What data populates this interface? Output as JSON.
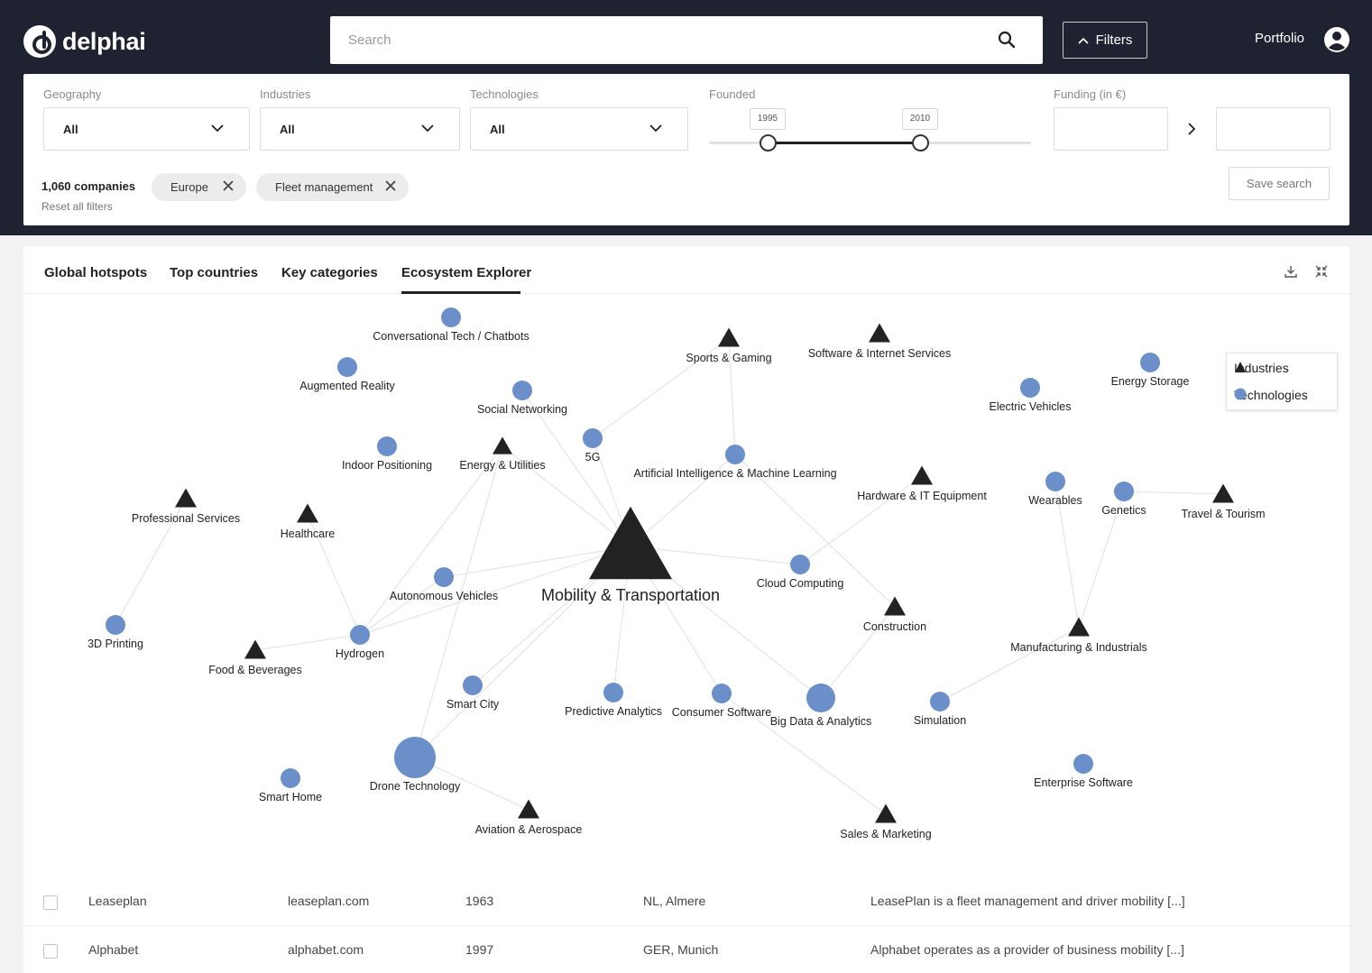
{
  "app": {
    "name": "delphai"
  },
  "header": {
    "search_placeholder": "Search",
    "filters_label": "Filters",
    "portfolio_label": "Portfolio"
  },
  "filters": {
    "geography": {
      "label": "Geography",
      "value": "All"
    },
    "industries": {
      "label": "Industries",
      "value": "All"
    },
    "technologies": {
      "label": "Technologies",
      "value": "All"
    },
    "founded": {
      "label": "Founded",
      "min": "1995",
      "max": "2010"
    },
    "funding": {
      "label": "Funding (in €)"
    },
    "count": "1,060 companies",
    "reset": "Reset all filters",
    "chips": [
      "Europe",
      "Fleet management"
    ],
    "save": "Save search"
  },
  "tabs": [
    "Global hotspots",
    "Top countries",
    "Key categories",
    "Ecosystem Explorer"
  ],
  "active_tab": "Ecosystem Explorer",
  "legend": {
    "industries": "Industries",
    "technologies": "Technologies"
  },
  "colors": {
    "header_bg": "#1f2230",
    "technology_node": "#6a8fc9",
    "industry_node": "#222222"
  },
  "graph": {
    "center": "Mobility & Transportation",
    "nodes": [
      {
        "id": "conv",
        "label": "Conversational Tech / Chatbots",
        "kind": "technology"
      },
      {
        "id": "ar",
        "label": "Augmented Reality",
        "kind": "technology"
      },
      {
        "id": "social",
        "label": "Social Networking",
        "kind": "technology"
      },
      {
        "id": "indoor",
        "label": "Indoor Positioning",
        "kind": "technology"
      },
      {
        "id": "energyu",
        "label": "Energy & Utilities",
        "kind": "industry"
      },
      {
        "id": "fiveg",
        "label": "5G",
        "kind": "technology"
      },
      {
        "id": "sports",
        "label": "Sports & Gaming",
        "kind": "industry"
      },
      {
        "id": "software",
        "label": "Software & Internet Services",
        "kind": "industry"
      },
      {
        "id": "aiml",
        "label": "Artificial Intelligence & Machine Learning",
        "kind": "technology"
      },
      {
        "id": "hardware",
        "label": "Hardware & IT Equipment",
        "kind": "industry"
      },
      {
        "id": "electric",
        "label": "Electric Vehicles",
        "kind": "technology"
      },
      {
        "id": "storage",
        "label": "Energy Storage",
        "kind": "technology"
      },
      {
        "id": "wearables",
        "label": "Wearables",
        "kind": "technology"
      },
      {
        "id": "genetics",
        "label": "Genetics",
        "kind": "technology"
      },
      {
        "id": "travel",
        "label": "Travel & Tourism",
        "kind": "industry"
      },
      {
        "id": "profserv",
        "label": "Professional Services",
        "kind": "industry"
      },
      {
        "id": "health",
        "label": "Healthcare",
        "kind": "industry"
      },
      {
        "id": "autonomous",
        "label": "Autonomous Vehicles",
        "kind": "technology"
      },
      {
        "id": "mobility",
        "label": "Mobility & Transportation",
        "kind": "industry"
      },
      {
        "id": "cloud",
        "label": "Cloud Computing",
        "kind": "technology"
      },
      {
        "id": "construction",
        "label": "Construction",
        "kind": "industry"
      },
      {
        "id": "manufacturing",
        "label": "Manufacturing & Industrials",
        "kind": "industry"
      },
      {
        "id": "print3d",
        "label": "3D Printing",
        "kind": "technology"
      },
      {
        "id": "food",
        "label": "Food & Beverages",
        "kind": "industry"
      },
      {
        "id": "hydrogen",
        "label": "Hydrogen",
        "kind": "technology"
      },
      {
        "id": "smartcity",
        "label": "Smart City",
        "kind": "technology"
      },
      {
        "id": "predictive",
        "label": "Predictive Analytics",
        "kind": "technology"
      },
      {
        "id": "consumer",
        "label": "Consumer Software",
        "kind": "technology"
      },
      {
        "id": "bigdata",
        "label": "Big Data & Analytics",
        "kind": "technology"
      },
      {
        "id": "simulation",
        "label": "Simulation",
        "kind": "technology"
      },
      {
        "id": "drone",
        "label": "Drone Technology",
        "kind": "technology"
      },
      {
        "id": "smarthome",
        "label": "Smart Home",
        "kind": "technology"
      },
      {
        "id": "enterprise",
        "label": "Enterprise Software",
        "kind": "technology"
      },
      {
        "id": "aviation",
        "label": "Aviation & Aerospace",
        "kind": "industry"
      },
      {
        "id": "sales",
        "label": "Sales & Marketing",
        "kind": "industry"
      }
    ],
    "edges": [
      [
        "mobility",
        "energyu"
      ],
      [
        "mobility",
        "fiveg"
      ],
      [
        "mobility",
        "aiml"
      ],
      [
        "mobility",
        "cloud"
      ],
      [
        "mobility",
        "autonomous"
      ],
      [
        "mobility",
        "hydrogen"
      ],
      [
        "mobility",
        "smartcity"
      ],
      [
        "mobility",
        "predictive"
      ],
      [
        "mobility",
        "consumer"
      ],
      [
        "mobility",
        "bigdata"
      ],
      [
        "mobility",
        "drone"
      ],
      [
        "mobility",
        "social"
      ],
      [
        "fiveg",
        "sports"
      ],
      [
        "sports",
        "aiml"
      ],
      [
        "aiml",
        "construction"
      ],
      [
        "cloud",
        "hardware"
      ],
      [
        "construction",
        "bigdata"
      ],
      [
        "energyu",
        "hydrogen"
      ],
      [
        "energyu",
        "drone"
      ],
      [
        "health",
        "hydrogen"
      ],
      [
        "profserv",
        "print3d"
      ],
      [
        "food",
        "hydrogen"
      ],
      [
        "hydrogen",
        "autonomous"
      ],
      [
        "drone",
        "aviation"
      ],
      [
        "consumer",
        "sales"
      ],
      [
        "manufacturing",
        "wearables"
      ],
      [
        "manufacturing",
        "genetics"
      ],
      [
        "genetics",
        "travel"
      ],
      [
        "manufacturing",
        "simulation"
      ]
    ]
  },
  "companies": [
    {
      "name": "Leaseplan",
      "domain": "leaseplan.com",
      "founded": "1963",
      "location": "NL, Almere",
      "description": "LeasePlan is a fleet management and driver mobility [...]"
    },
    {
      "name": "Alphabet",
      "domain": "alphabet.com",
      "founded": "1997",
      "location": "GER, Munich",
      "description": "Alphabet operates as a provider of business mobility [...]"
    }
  ]
}
